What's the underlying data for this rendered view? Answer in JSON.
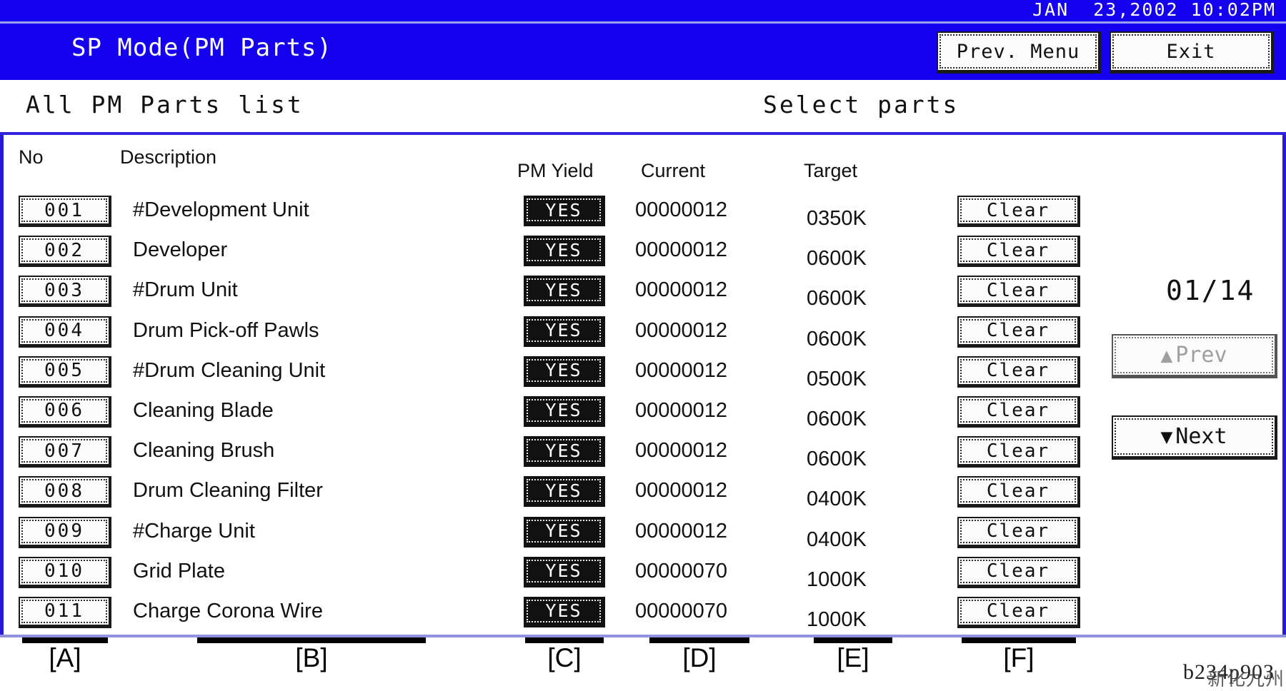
{
  "header": {
    "datetime": "JAN  23,2002 10:02PM",
    "title": "SP Mode(PM Parts)",
    "prev_menu_label": "Prev. Menu",
    "exit_label": "Exit",
    "band_color": "#1400ee"
  },
  "subheader": {
    "left_title": "All PM Parts list",
    "right_title": "Select parts",
    "rule_color": "#3322dd"
  },
  "columns": {
    "no": "No",
    "description": "Description",
    "pm_yield": "PM Yield",
    "current": "Current",
    "target": "Target"
  },
  "rows": [
    {
      "no": "001",
      "description": "#Development Unit",
      "pm_yield": "YES",
      "current": "00000012",
      "target": "0350K",
      "clear": "Clear"
    },
    {
      "no": "002",
      "description": "Developer",
      "pm_yield": "YES",
      "current": "00000012",
      "target": "0600K",
      "clear": "Clear"
    },
    {
      "no": "003",
      "description": "#Drum Unit",
      "pm_yield": "YES",
      "current": "00000012",
      "target": "0600K",
      "clear": "Clear"
    },
    {
      "no": "004",
      "description": "Drum Pick-off Pawls",
      "pm_yield": "YES",
      "current": "00000012",
      "target": "0600K",
      "clear": "Clear"
    },
    {
      "no": "005",
      "description": "#Drum Cleaning Unit",
      "pm_yield": "YES",
      "current": "00000012",
      "target": "0500K",
      "clear": "Clear"
    },
    {
      "no": "006",
      "description": "Cleaning Blade",
      "pm_yield": "YES",
      "current": "00000012",
      "target": "0600K",
      "clear": "Clear"
    },
    {
      "no": "007",
      "description": "Cleaning Brush",
      "pm_yield": "YES",
      "current": "00000012",
      "target": "0600K",
      "clear": "Clear"
    },
    {
      "no": "008",
      "description": "Drum Cleaning Filter",
      "pm_yield": "YES",
      "current": "00000012",
      "target": "0400K",
      "clear": "Clear"
    },
    {
      "no": "009",
      "description": "#Charge Unit",
      "pm_yield": "YES",
      "current": "00000012",
      "target": "0400K",
      "clear": "Clear"
    },
    {
      "no": "010",
      "description": "Grid Plate",
      "pm_yield": "YES",
      "current": "00000070",
      "target": "1000K",
      "clear": "Clear"
    },
    {
      "no": "011",
      "description": "Charge Corona Wire",
      "pm_yield": "YES",
      "current": "00000070",
      "target": "1000K",
      "clear": "Clear"
    }
  ],
  "pager": {
    "indicator": "01/14",
    "prev_label": "Prev",
    "prev_arrow": "▲",
    "prev_disabled": true,
    "next_label": "Next",
    "next_arrow": "▼"
  },
  "callouts": [
    {
      "tag": "[A]"
    },
    {
      "tag": "[B]"
    },
    {
      "tag": "[C]"
    },
    {
      "tag": "[D]"
    },
    {
      "tag": "[E]"
    },
    {
      "tag": "[F]"
    }
  ],
  "watermark": {
    "code": "b234p903",
    "overlay": "新化九州"
  }
}
